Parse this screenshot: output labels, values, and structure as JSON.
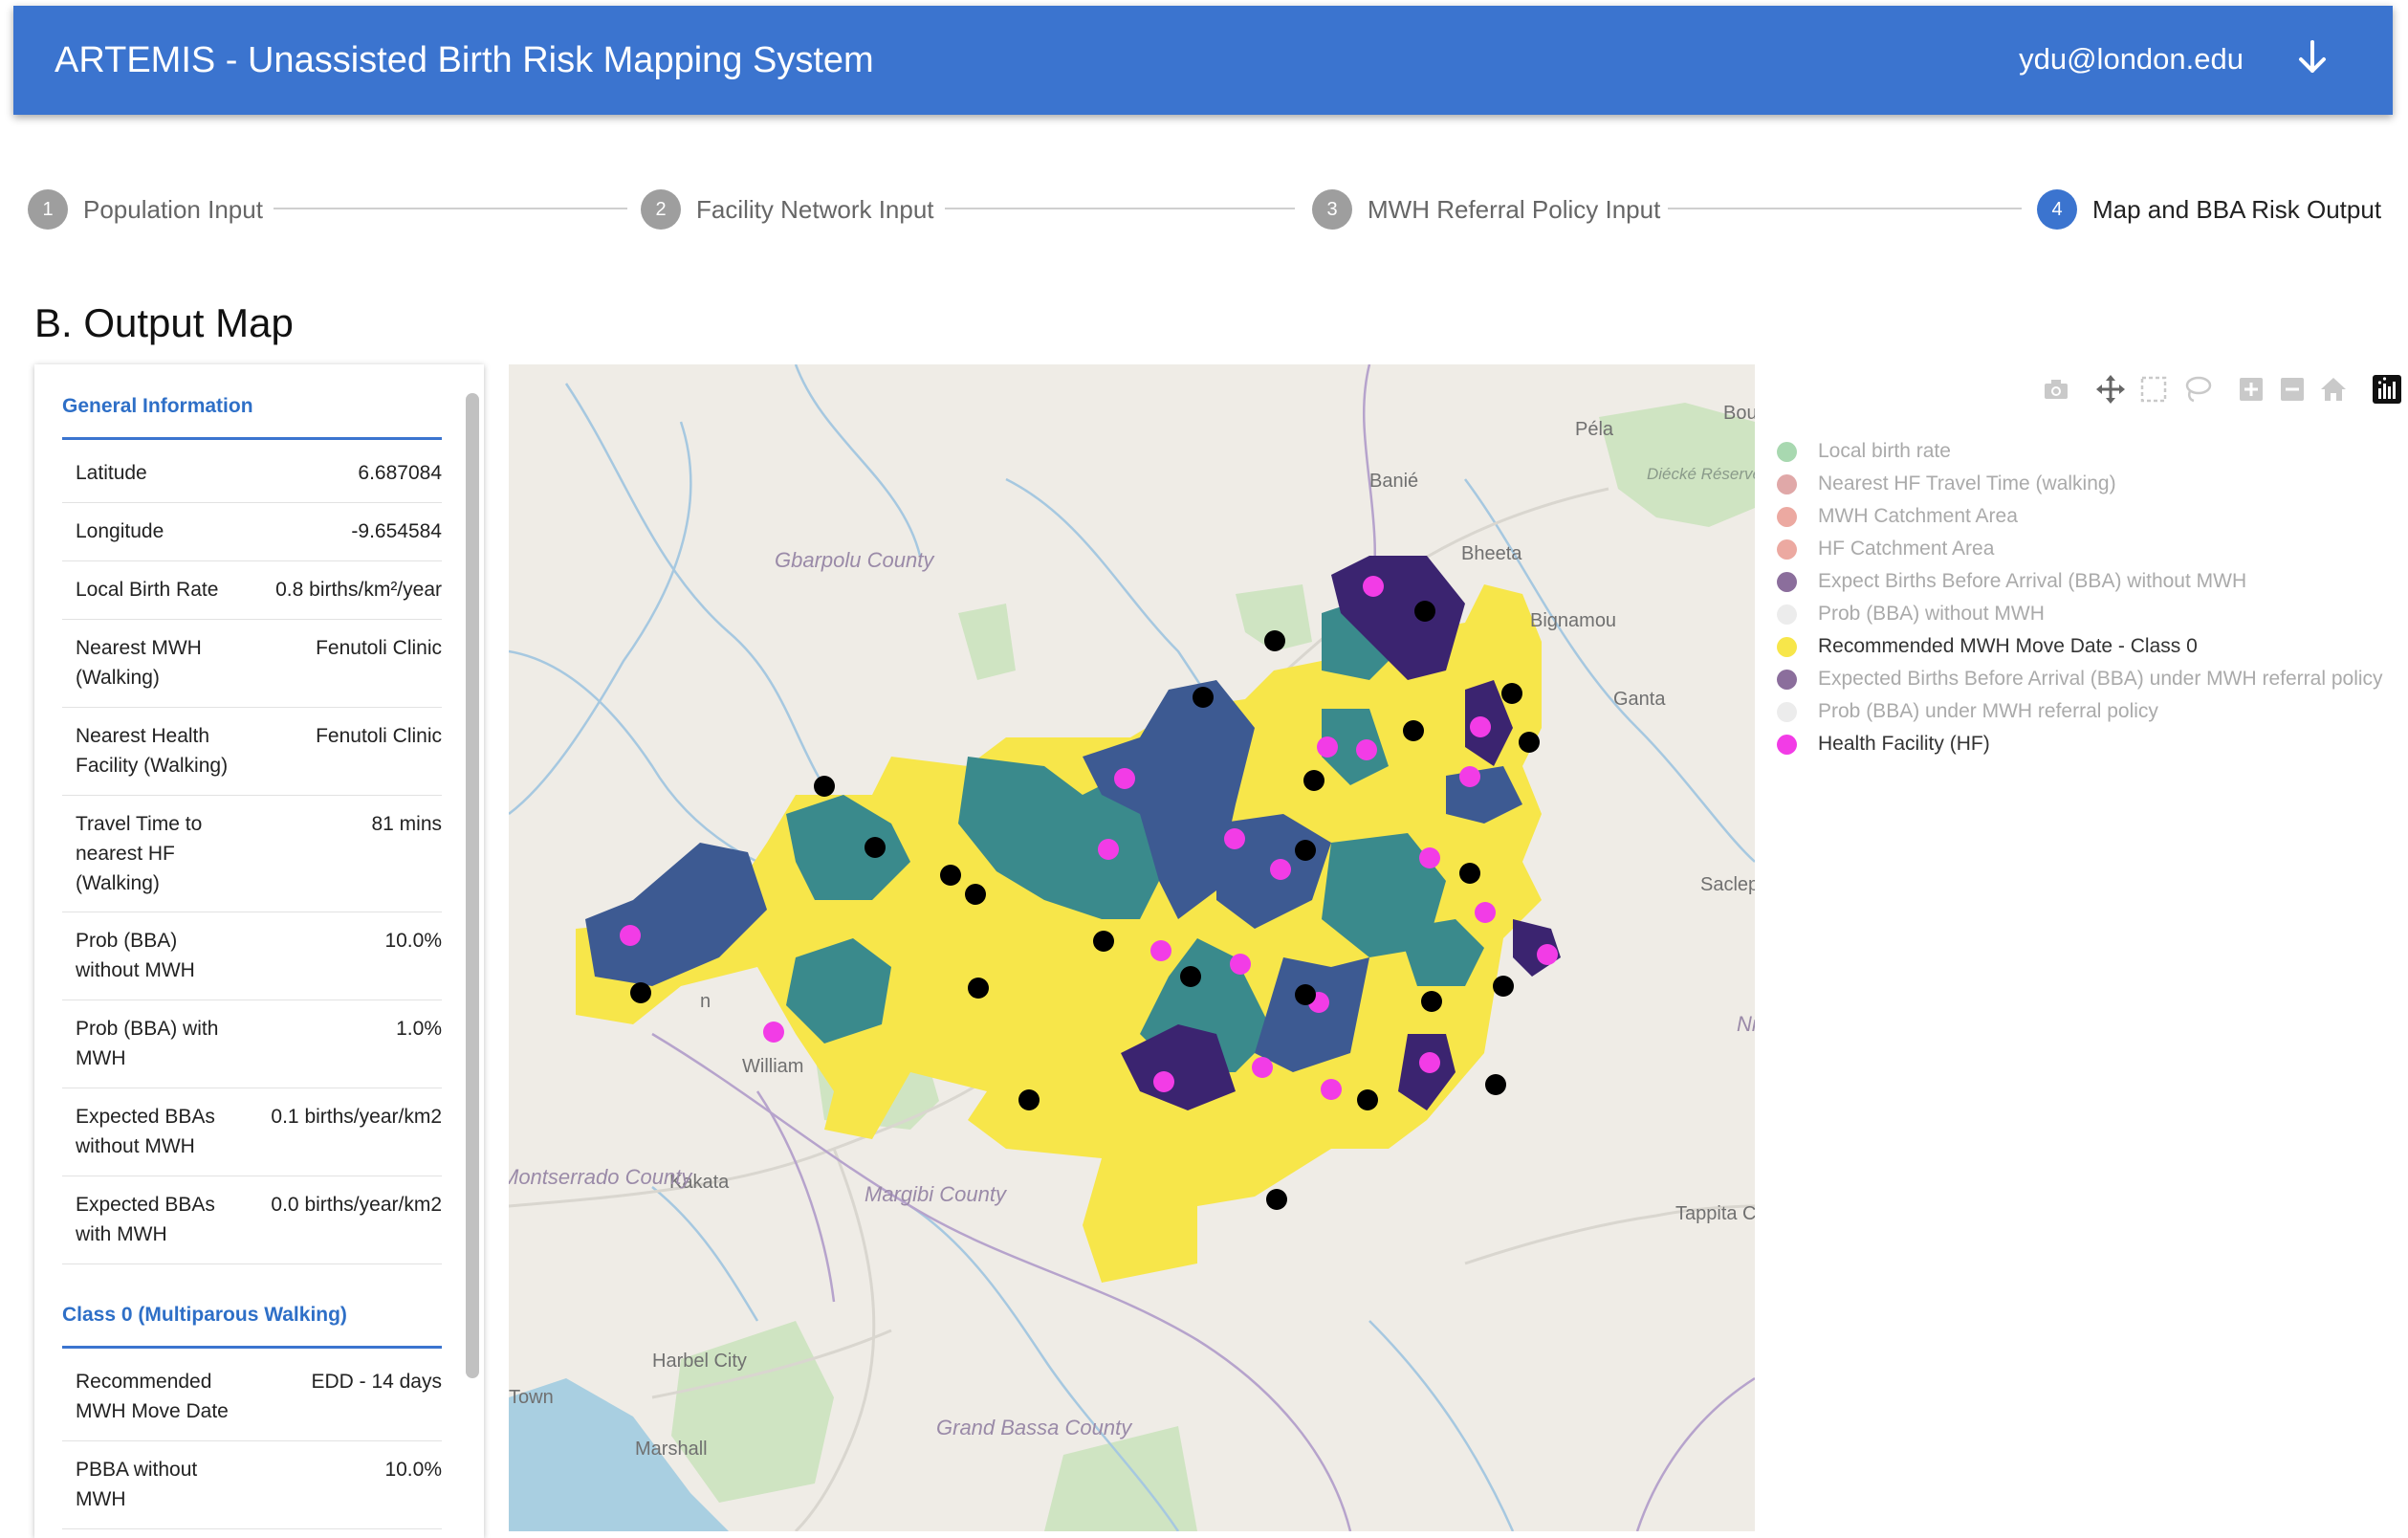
{
  "header": {
    "title": "ARTEMIS - Unassisted Birth Risk Mapping System",
    "user_email": "ydu@london.edu"
  },
  "stepper": {
    "steps": [
      {
        "number": "1",
        "label": "Population Input",
        "active": false
      },
      {
        "number": "2",
        "label": "Facility Network Input",
        "active": false
      },
      {
        "number": "3",
        "label": "MWH Referral Policy Input",
        "active": false
      },
      {
        "number": "4",
        "label": "Map and BBA Risk Output",
        "active": true
      }
    ]
  },
  "section_title": "B. Output Map",
  "info_panel": {
    "general_heading": "General Information",
    "general_rows": [
      {
        "key": "Latitude",
        "value": "6.687084"
      },
      {
        "key": "Longitude",
        "value": "-9.654584"
      },
      {
        "key": "Local Birth Rate",
        "value": "0.8 births/km²/year"
      },
      {
        "key": "Nearest MWH (Walking)",
        "value": "Fenutoli Clinic"
      },
      {
        "key": "Nearest Health Facility (Walking)",
        "value": "Fenutoli Clinic"
      },
      {
        "key": "Travel Time to nearest HF (Walking)",
        "value": "81 mins"
      },
      {
        "key": "Prob (BBA) without MWH",
        "value": "10.0%"
      },
      {
        "key": "Prob (BBA) with MWH",
        "value": "1.0%"
      },
      {
        "key": "Expected BBAs without MWH",
        "value": "0.1 births/year/km2"
      },
      {
        "key": "Expected BBAs with MWH",
        "value": "0.0 births/year/km2"
      }
    ],
    "class_heading": "Class 0 (Multiparous Walking)",
    "class_rows": [
      {
        "key": "Recommended MWH Move Date",
        "value": "EDD - 14 days"
      },
      {
        "key": "PBBA without MWH",
        "value": "10.0%"
      }
    ]
  },
  "map": {
    "place_labels": [
      "Péla",
      "Banié",
      "Bheeta",
      "Bignamou",
      "Ganta",
      "Saclep",
      "Bou",
      "Diécké Réserve de Biosphère",
      "Gbarpolu County",
      "William",
      "Kakata",
      "Margibi County",
      "Montserrado County",
      "Harbel City",
      "Town",
      "Marshall",
      "Grand Bassa County",
      "Tappita C",
      "Ni",
      "n"
    ],
    "colors": {
      "risk_yellow": "#f7e64a",
      "risk_teal": "#3a8a8c",
      "risk_blue": "#3d5a92",
      "risk_purple": "#3b2470",
      "health_facility": "#f23ce6",
      "mwh_site": "#000000"
    }
  },
  "modebar": {
    "icons": [
      "camera-icon",
      "pan-icon",
      "box-select-icon",
      "lasso-icon",
      "zoom-in-icon",
      "zoom-out-icon",
      "home-icon",
      "plotly-logo-icon"
    ]
  },
  "legend": {
    "items": [
      {
        "label": "Local birth rate",
        "color": "#a8d8b0",
        "active": false
      },
      {
        "label": "Nearest HF Travel Time (walking)",
        "color": "#e0a8a8",
        "active": false
      },
      {
        "label": "MWH Catchment Area",
        "color": "#eca9a1",
        "active": false
      },
      {
        "label": "HF Catchment Area",
        "color": "#eca9a1",
        "active": false
      },
      {
        "label": "Expect Births Before Arrival (BBA) without MWH",
        "color": "#8b6e9c",
        "active": false
      },
      {
        "label": "Prob (BBA) without MWH",
        "color": "#ececec",
        "active": false
      },
      {
        "label": "Recommended MWH Move Date - Class 0",
        "color": "#f7e64a",
        "active": true
      },
      {
        "label": "Expected Births Before Arrival (BBA) under MWH referral policy",
        "color": "#8b6e9c",
        "active": false
      },
      {
        "label": "Prob (BBA) under MWH referral policy",
        "color": "#ececec",
        "active": false
      },
      {
        "label": "Health Facility (HF)",
        "color": "#f23ce6",
        "active": true
      }
    ]
  }
}
